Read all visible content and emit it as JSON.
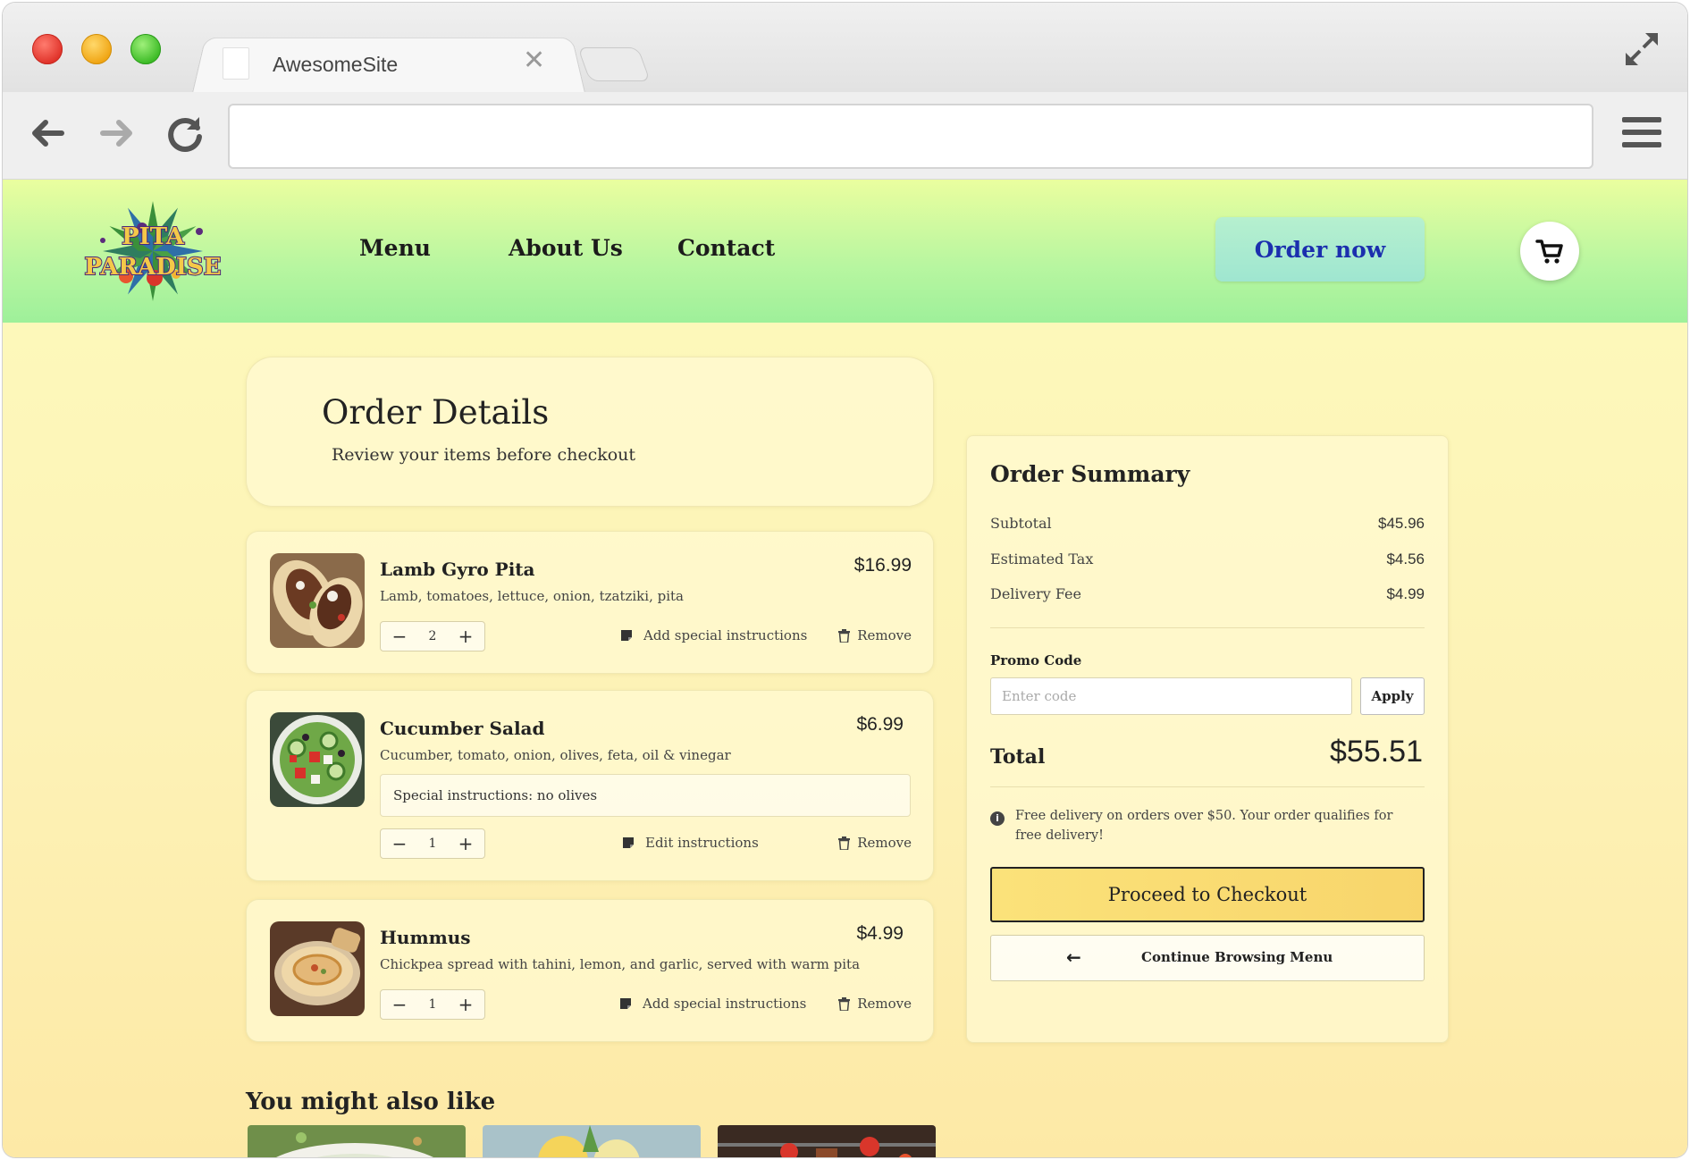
{
  "browser": {
    "tab_title": "AwesomeSite",
    "tab_close": "✕",
    "url": ""
  },
  "site": {
    "logo_text": [
      "PITA",
      "PARADISE"
    ],
    "nav": [
      "Menu",
      "About Us",
      "Contact"
    ],
    "order_now": "Order now"
  },
  "order_details": {
    "title": "Order Details",
    "subtitle": "Review your items before checkout"
  },
  "items": [
    {
      "name": "Lamb Gyro Pita",
      "desc": "Lamb, tomatoes, lettuce, onion, tzatziki, pita",
      "price": "$16.99",
      "qty": "2",
      "instructions_link": "Add special instructions",
      "remove": "Remove"
    },
    {
      "name": "Cucumber Salad",
      "desc": "Cucumber, tomato, onion, olives, feta, oil & vinegar",
      "price": "$6.99",
      "qty": "1",
      "special": "Special instructions: no olives",
      "instructions_link": "Edit instructions",
      "remove": "Remove"
    },
    {
      "name": "Hummus",
      "desc": "Chickpea spread with tahini, lemon, and garlic, served with warm pita",
      "price": "$4.99",
      "qty": "1",
      "instructions_link": "Add special instructions",
      "remove": "Remove"
    }
  ],
  "stepper": {
    "minus": "−",
    "plus": "+"
  },
  "recommend": {
    "title": "You might also like"
  },
  "summary": {
    "title": "Order Summary",
    "rows": [
      {
        "label": "Subtotal",
        "value": "$45.96"
      },
      {
        "label": "Estimated Tax",
        "value": "$4.56"
      },
      {
        "label": "Delivery Fee",
        "value": "$4.99"
      }
    ],
    "promo_label": "Promo Code",
    "promo_placeholder": "Enter code",
    "apply": "Apply",
    "total_label": "Total",
    "total_value": "$55.51",
    "note": "Free delivery on orders over $50. Your order qualifies for free delivery!",
    "checkout": "Proceed to Checkout",
    "continue": "Continue Browsing Menu"
  },
  "colors": {
    "header_gradient_top": "#eafe9f",
    "header_gradient_bottom": "#9ef09a",
    "page_bg": "#fdf7b8",
    "order_now_bg": "#aeeccf",
    "order_now_text": "#1b2fae",
    "checkout_bg": "#f9d96f"
  },
  "icons": [
    "back-arrow-icon",
    "forward-arrow-icon",
    "reload-icon",
    "menu-icon",
    "fullscreen-icon",
    "cart-icon",
    "note-icon",
    "trash-icon",
    "info-icon",
    "arrow-left-icon"
  ]
}
